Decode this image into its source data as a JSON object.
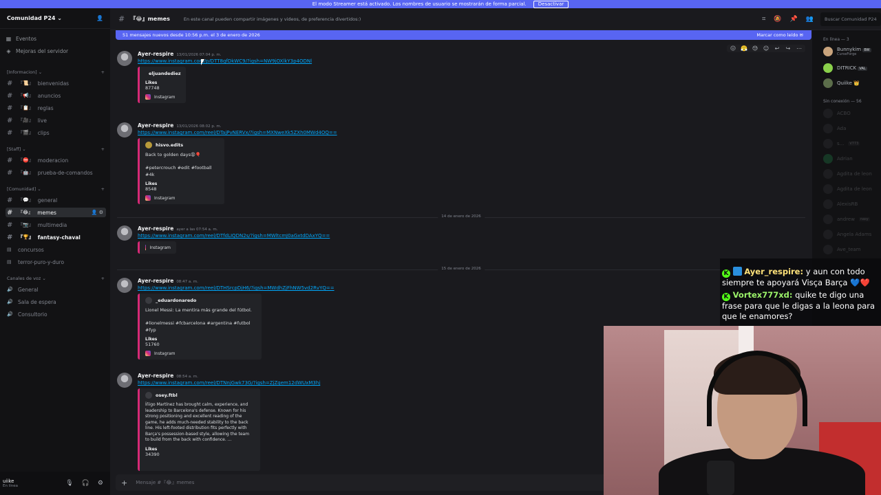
{
  "banner": {
    "text": "El modo Streamer está activado. Los nombres de usuario se mostrarán de forma parcial.",
    "button": "Desactivar"
  },
  "server": {
    "name": "Comunidad P24",
    "top_items": [
      {
        "label": "Eventos",
        "icon": "calendar-icon"
      },
      {
        "label": "Mejoras del servidor",
        "icon": "boost-icon"
      }
    ],
    "categories": [
      {
        "name": "[Informacion]",
        "channels": [
          {
            "emoji": "『📜』",
            "label": "bienvenidas"
          },
          {
            "emoji": "『📢』",
            "label": "anuncios"
          },
          {
            "emoji": "『📋』",
            "label": "reglas"
          },
          {
            "emoji": "『🎥』",
            "label": "live"
          },
          {
            "emoji": "『🎬』",
            "label": "clips"
          }
        ]
      },
      {
        "name": "[Staff]",
        "channels": [
          {
            "emoji": "『⛔』",
            "label": "moderacion"
          },
          {
            "emoji": "『🤖』",
            "label": "prueba-de-comandos"
          }
        ]
      },
      {
        "name": "[Comunidad]",
        "channels": [
          {
            "emoji": "『💬』",
            "label": "general"
          },
          {
            "emoji": "『😂』",
            "label": "memes",
            "active": true
          },
          {
            "emoji": "『📷』",
            "label": "multimedia"
          },
          {
            "emoji": "『🏆』",
            "label": "fantasy-chaval",
            "bold": true
          },
          {
            "emoji": "",
            "label": "concursos"
          },
          {
            "emoji": "",
            "label": "terror-puro-y-duro"
          }
        ]
      },
      {
        "name": "Canales de voz",
        "channels": [
          {
            "emoji": "",
            "label": "General"
          },
          {
            "emoji": "",
            "label": "Sala de espera"
          },
          {
            "emoji": "",
            "label": "Consultorio"
          }
        ]
      }
    ]
  },
  "user_bar": {
    "name": "uiike",
    "status": "En línea"
  },
  "channel": {
    "name": "『😂』memes",
    "topic": "En este canal pueden compartir imágenes y videos, de preferencia divertidos:)",
    "search_placeholder": "Buscar Comunidad P24"
  },
  "new_messages": {
    "text": "51 mensajes nuevos desde 10:56 p.m. el 3 de enero de 2026",
    "action": "Marcar como leído"
  },
  "messages": [
    {
      "author": "Ayer-respire",
      "time": "13/01/2026 07:04 p. m.",
      "link": "https://www.instagram.com/p/DTT8gfDkWC9/?igsh=NW9jOXlkY3p4ODNl",
      "embed": {
        "author": "eljuandediez",
        "desc": "",
        "likes_label": "Likes",
        "likes": "87748",
        "footer": "Instagram"
      }
    },
    {
      "author": "Ayer-respire",
      "time": "13/01/2026 08:02 p. m.",
      "link": "https://www.instagram.com/reel/DTajPvNERVx/?igsh=MXNweXk5ZXh0MWd4OQ==",
      "embed": {
        "author": "hisvo.edits",
        "desc": "Back to golden days😩🎈\n\n#petercrouch #edit #football #4k",
        "likes_label": "Likes",
        "likes": "8548",
        "footer": "Instagram"
      }
    },
    {
      "author": "Ayer-respire",
      "time": "ayer a las 07:54 a. m.",
      "link": "https://www.instagram.com/reel/DTfdLIQDN2s/?igsh=MWltcmJ0aGxtdDAxYQ==",
      "embed": {
        "author": "",
        "desc": "",
        "likes_label": "",
        "likes": "",
        "footer": "Instagram"
      }
    },
    {
      "author": "Ayer-respire",
      "time": "08:47 a. m.",
      "link": "https://www.instagram.com/reel/DTHSrcpDjH6/?igsh=MWdhZjFhNW5vd2RvYQ==",
      "embed": {
        "author": "_eduardonaredo",
        "desc": "Lionel Messi: La mentira más grande del fútbol.\n\n#lionelmessi #fcbarcelona #argentina #futbol #fyp",
        "likes_label": "Likes",
        "likes": "51760",
        "footer": "Instagram"
      }
    },
    {
      "author": "Ayer-respire",
      "time": "08:54 a. m.",
      "link": "https://www.instagram.com/reel/DTNnjGwk73G/?igsh=ZjZqem12dWUxM3hj",
      "embed": {
        "author": "osey.ftbl",
        "desc": "Íñigo Martínez has brought calm, experience, and\nleadership to Barcelona's defense. Known for his\nstrong positioning and excellent reading of the\ngame, he adds much-needed stability to the back\nline. His left-footed distribution fits perfectly with\nBarça's possession-based style, allowing the team\nto build from the back with confidence. ...",
        "likes_label": "Likes",
        "likes": "34390",
        "footer": ""
      }
    }
  ],
  "dividers": [
    "14 de enero de 2026",
    "15 de enero de 2026"
  ],
  "composer": {
    "placeholder": "Mensaje #『😂』memes"
  },
  "members": {
    "online_header": "En línea — 3",
    "online": [
      {
        "name": "Bunnykim",
        "sub": "CurseForge",
        "tag": "BW"
      },
      {
        "name": "DITRICK",
        "sub": "",
        "tag": "VAL"
      },
      {
        "name": "Quiike 👑",
        "sub": "",
        "tag": ""
      }
    ],
    "offline_header": "Sin conexión — 56",
    "offline": [
      "ACBO",
      "Ada",
      "s...",
      "Adrian",
      "Agdita de leon",
      "Agdita de leon",
      "AlexisRB",
      "andrew",
      "Angela Adams",
      "Ave_team"
    ],
    "offline_tags": {
      "2": "V773",
      "7": "nasy"
    }
  },
  "stream_chat": [
    {
      "user": "Ayer_respire:",
      "text": " y aun con todo siempre te apoyará Visça Barça 💙❤️"
    },
    {
      "user": "Vortex777xd:",
      "text": " quike te digo una frase para que le digas a la leona para que le enamores?"
    }
  ]
}
